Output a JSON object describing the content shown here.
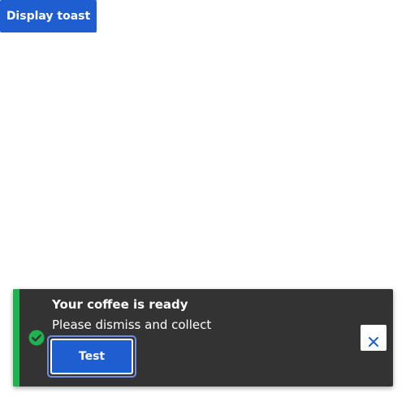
{
  "toolbar": {
    "display_toast_label": "Display toast"
  },
  "toast": {
    "title": "Your coffee is ready",
    "message": "Please dismiss and collect",
    "action_label": "Test",
    "status_icon": "check-circle-icon",
    "close_icon": "close-icon"
  },
  "colors": {
    "primary": "#1f5ed0",
    "toast_background": "#333333",
    "success_accent": "#1fb24e",
    "focus_ring": "#6d8fe8"
  }
}
